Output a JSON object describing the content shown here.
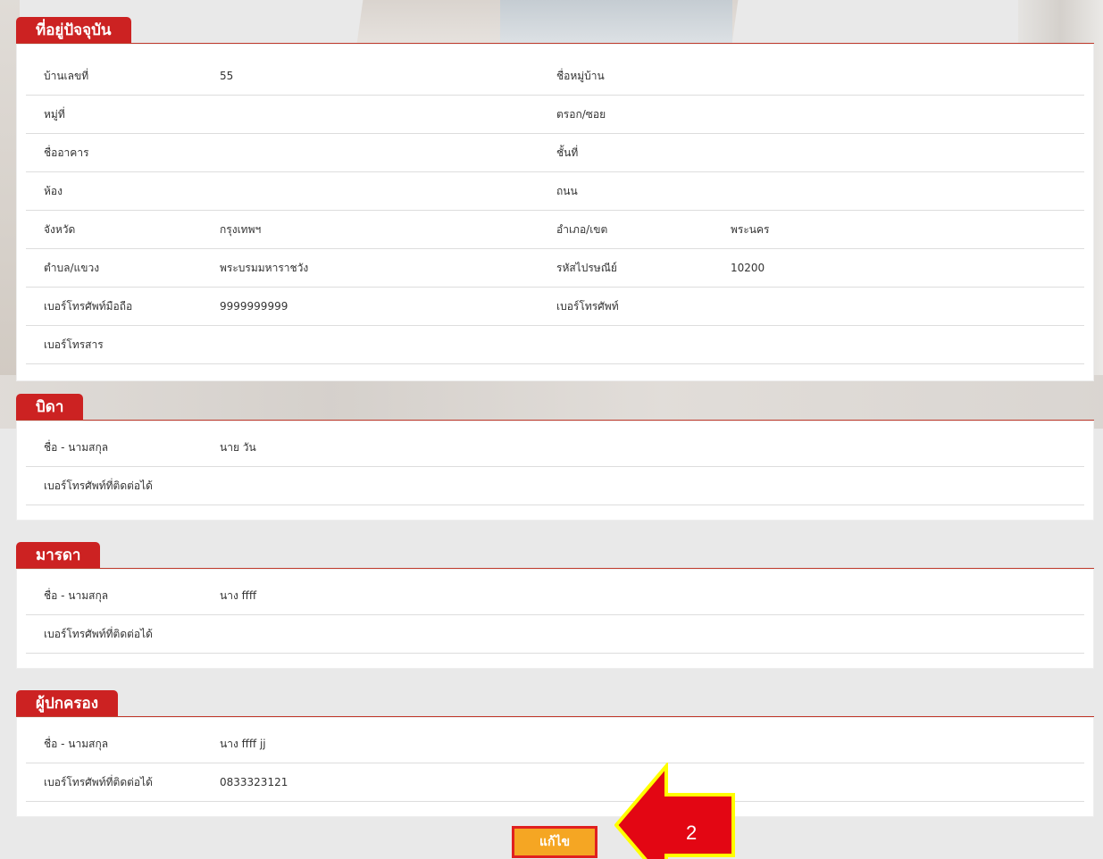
{
  "address": {
    "title": "ที่อยู่ปัจจุบัน",
    "rows": [
      {
        "l1": "บ้านเลขที่",
        "v1": "55",
        "l2": "ชื่อหมู่บ้าน",
        "v2": ""
      },
      {
        "l1": "หมู่ที่",
        "v1": "",
        "l2": "ตรอก/ซอย",
        "v2": ""
      },
      {
        "l1": "ชื่ออาคาร",
        "v1": "",
        "l2": "ชั้นที่",
        "v2": ""
      },
      {
        "l1": "ห้อง",
        "v1": "",
        "l2": "ถนน",
        "v2": ""
      },
      {
        "l1": "จังหวัด",
        "v1": "กรุงเทพฯ",
        "l2": "อำเภอ/เขต",
        "v2": "พระนคร"
      },
      {
        "l1": "ตำบล/แขวง",
        "v1": "พระบรมมหาราชวัง",
        "l2": "รหัสไปรษณีย์",
        "v2": "10200"
      },
      {
        "l1": "เบอร์โทรศัพท์มือถือ",
        "v1": "9999999999",
        "l2": "เบอร์โทรศัพท์",
        "v2": ""
      },
      {
        "l1": "เบอร์โทรสาร",
        "v1": "",
        "l2": "",
        "v2": ""
      }
    ]
  },
  "father": {
    "title": "บิดา",
    "rows": [
      {
        "l1": "ชื่อ - นามสกุล",
        "v1": "นาย วัน"
      },
      {
        "l1": "เบอร์โทรศัพท์ที่ติดต่อได้",
        "v1": ""
      }
    ]
  },
  "mother": {
    "title": "มารดา",
    "rows": [
      {
        "l1": "ชื่อ - นามสกุล",
        "v1": "นาง ffff"
      },
      {
        "l1": "เบอร์โทรศัพท์ที่ติดต่อได้",
        "v1": ""
      }
    ]
  },
  "guardian": {
    "title": "ผู้ปกครอง",
    "rows": [
      {
        "l1": "ชื่อ - นามสกุล",
        "v1": "นาง ffff jj"
      },
      {
        "l1": "เบอร์โทรศัพท์ที่ติดต่อได้",
        "v1": "0833323121"
      }
    ]
  },
  "edit_button": {
    "label": "แก้ไข"
  },
  "annotation": {
    "number": "2",
    "arrow_color": "#e30613",
    "outline_color": "#ffff00"
  }
}
